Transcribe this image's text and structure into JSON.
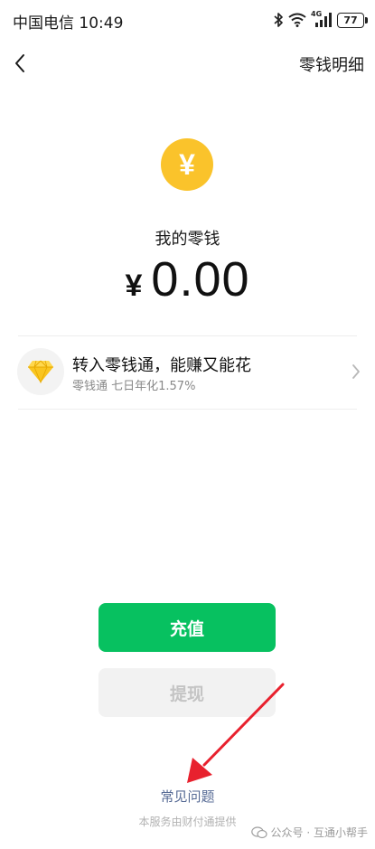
{
  "status_bar": {
    "carrier_time": "中国电信 10:49",
    "signal_label": "4G",
    "battery_level": "77"
  },
  "nav": {
    "detail_label": "零钱明细"
  },
  "balance": {
    "icon_symbol": "¥",
    "title": "我的零钱",
    "currency": "¥",
    "amount": "0.00"
  },
  "promo": {
    "title": "转入零钱通，能赚又能花",
    "subtitle": "零钱通 七日年化1.57%"
  },
  "actions": {
    "recharge_label": "充值",
    "withdraw_label": "提现"
  },
  "footer": {
    "faq_label": "常见问题",
    "service_note": "本服务由财付通提供",
    "watermark": "公众号 · 互通小帮手"
  },
  "colors": {
    "accent_green": "#07c160",
    "coin_yellow": "#fac32b",
    "link_blue": "#576b95",
    "annotation_red": "#e8212e"
  },
  "icons": [
    "back-arrow-icon",
    "yen-icon",
    "diamond-icon",
    "chevron-right-icon",
    "bluetooth-icon",
    "wifi-icon",
    "cellular-signal-icon",
    "battery-icon",
    "wechat-icon"
  ]
}
